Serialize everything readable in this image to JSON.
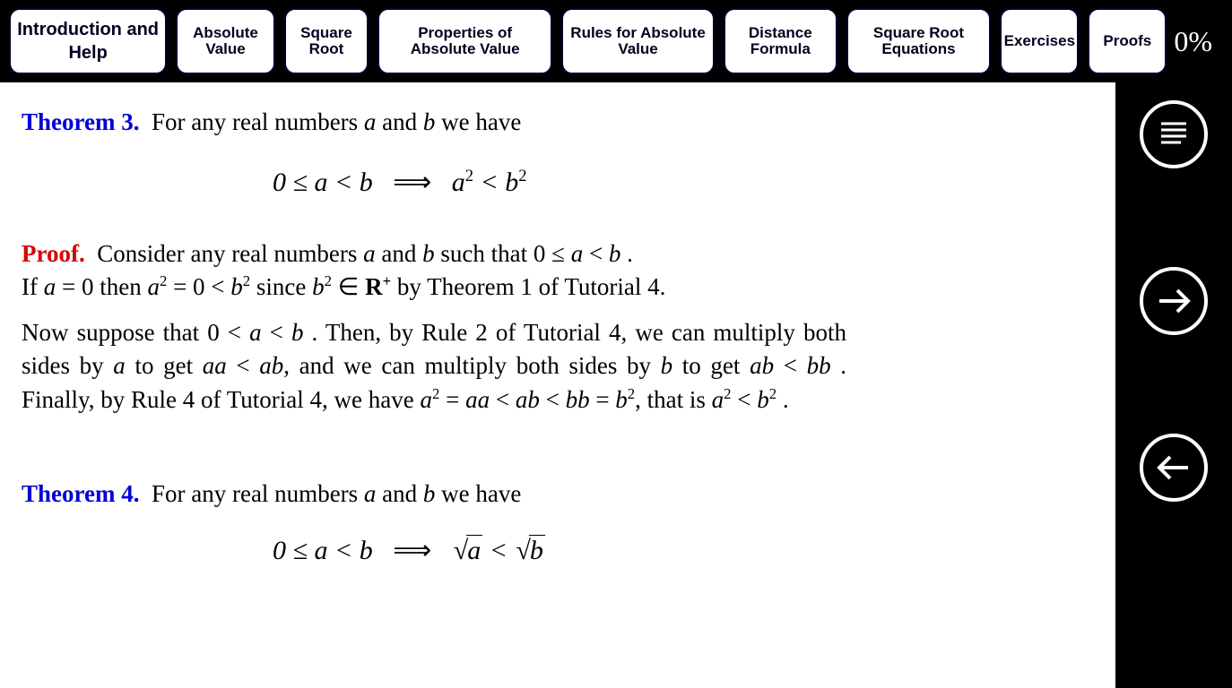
{
  "progress": "0%",
  "tabs": [
    "Introduction and Help",
    "Absolute Value",
    "Square Root",
    "Properties of Absolute Value",
    "Rules for Absolute Value",
    "Distance Formula",
    "Square Root Equations",
    "Exercises",
    "Proofs"
  ],
  "content": {
    "theorem3": {
      "label": "Theorem 3.",
      "intro": "For any real numbers ",
      "var_a": "a",
      "mid1": " and ",
      "var_b": "b",
      "outro": " we have",
      "formula_lhs": "0 ≤ a < b",
      "formula_arrow": "⟹",
      "formula_rhs_a": "a",
      "formula_rhs_lt": " < ",
      "formula_rhs_b": "b"
    },
    "proof": {
      "label": "Proof.",
      "p1_a": "Consider any real numbers ",
      "p1_b": " and ",
      "p1_c": " such that 0 ≤ ",
      "p1_d": " < ",
      "p1_e": " .",
      "p2_a": "If ",
      "p2_b": " = 0 then ",
      "p2_c": " = 0 < ",
      "p2_d": " since ",
      "p2_e": " ∈ ",
      "p2_R": "R",
      "p2_f": " by Theorem 1 of Tutorial 4.",
      "p3_a": "Now suppose that 0 < ",
      "p3_b": " < ",
      "p3_c": " . Then, by Rule 2 of Tutorial 4, we can multiply both sides by ",
      "p3_d": " to get ",
      "p3_e": " < ",
      "p3_f": ", and we can multiply both sides by ",
      "p3_g": " to get ",
      "p3_h": " < ",
      "p3_i": " . Finally, by Rule 4 of Tutorial 4, we have ",
      "p3_j": " = ",
      "p3_k": " < ",
      "p3_l": " < ",
      "p3_m": " = ",
      "p3_n": ", that is ",
      "p3_o": " < ",
      "p3_p": " .",
      "aa": "aa",
      "ab": "ab",
      "bb": "bb"
    },
    "theorem4": {
      "label": "Theorem 4.",
      "intro": "For any real numbers ",
      "mid1": " and ",
      "outro": " we have",
      "formula_lhs": "0 ≤ a < b",
      "formula_arrow": "⟹",
      "formula_lt": " < "
    }
  }
}
